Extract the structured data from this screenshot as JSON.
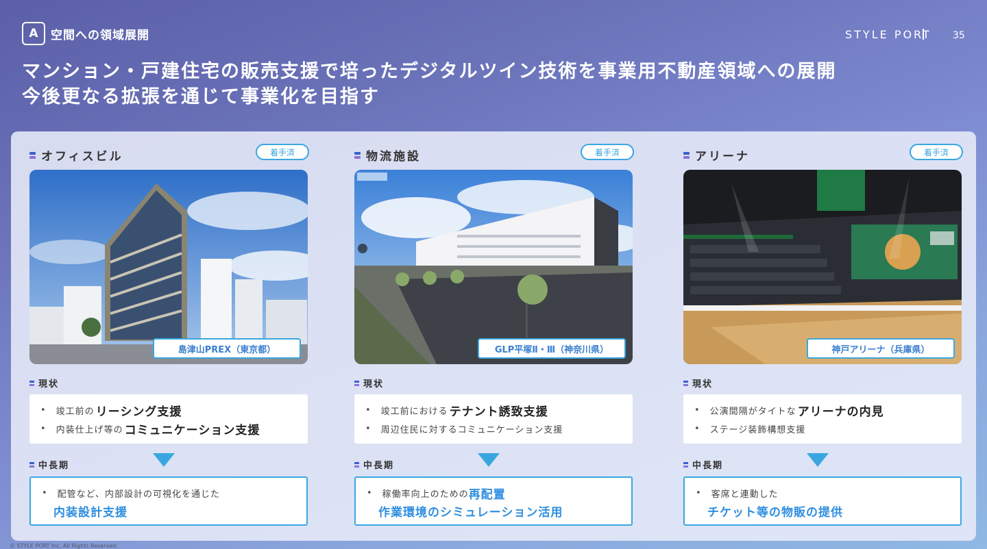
{
  "header": {
    "section_badge": "A",
    "section_title": "空間への領域展開",
    "brand": "STYLE PORT",
    "page_number": "35",
    "headline_line1": "マンション・戸建住宅の販売支援で培ったデジタルツイン技術を事業用不動産領域への展開",
    "headline_line2": "今後更なる拡張を通じて事業化を目指す"
  },
  "columns": [
    {
      "title": "オフィスビル",
      "status": "着手済",
      "photo_label": "島津山PREX（東京都）",
      "current_label": "現状",
      "current": [
        {
          "prefix": "竣工前の",
          "bold": "リーシング支援"
        },
        {
          "prefix": "内装仕上げ等の",
          "bold": "コミュニケーション支援"
        }
      ],
      "future_label": "中長期",
      "future_line": "配管など、内部設計の可視化を通じた",
      "future_highlight": "内装設計支援"
    },
    {
      "title": "物流施設",
      "status": "着手済",
      "photo_label": "GLP平塚Ⅱ・Ⅲ（神奈川県）",
      "current_label": "現状",
      "current": [
        {
          "prefix": "竣工前における",
          "bold": "テナント誘致支援"
        },
        {
          "prefix": "周辺住民に対するコミュニケーション支援",
          "bold": ""
        }
      ],
      "future_label": "中長期",
      "future_line": "稼働率向上のための",
      "future_line_highlight": "再配置",
      "future_highlight": "作業環境のシミュレーション活用"
    },
    {
      "title": "アリーナ",
      "status": "着手済",
      "photo_label": "神戸アリーナ（兵庫県）",
      "current_label": "現状",
      "current": [
        {
          "prefix": "公演間隔がタイトな",
          "bold": "アリーナの内見"
        },
        {
          "prefix": "ステージ装飾構想支援",
          "bold": ""
        }
      ],
      "future_label": "中長期",
      "future_line": "客席と連動した",
      "future_highlight": "チケット等の物販の提供"
    }
  ],
  "footer": {
    "copyright": "© STYLE PORT Inc. All Rights Reserved."
  },
  "colors": {
    "accent": "#3aa6e0",
    "highlight_text": "#2f8ee0",
    "bullet_blue": "#3b5fd0",
    "bullet_purple": "#8a72d8"
  }
}
